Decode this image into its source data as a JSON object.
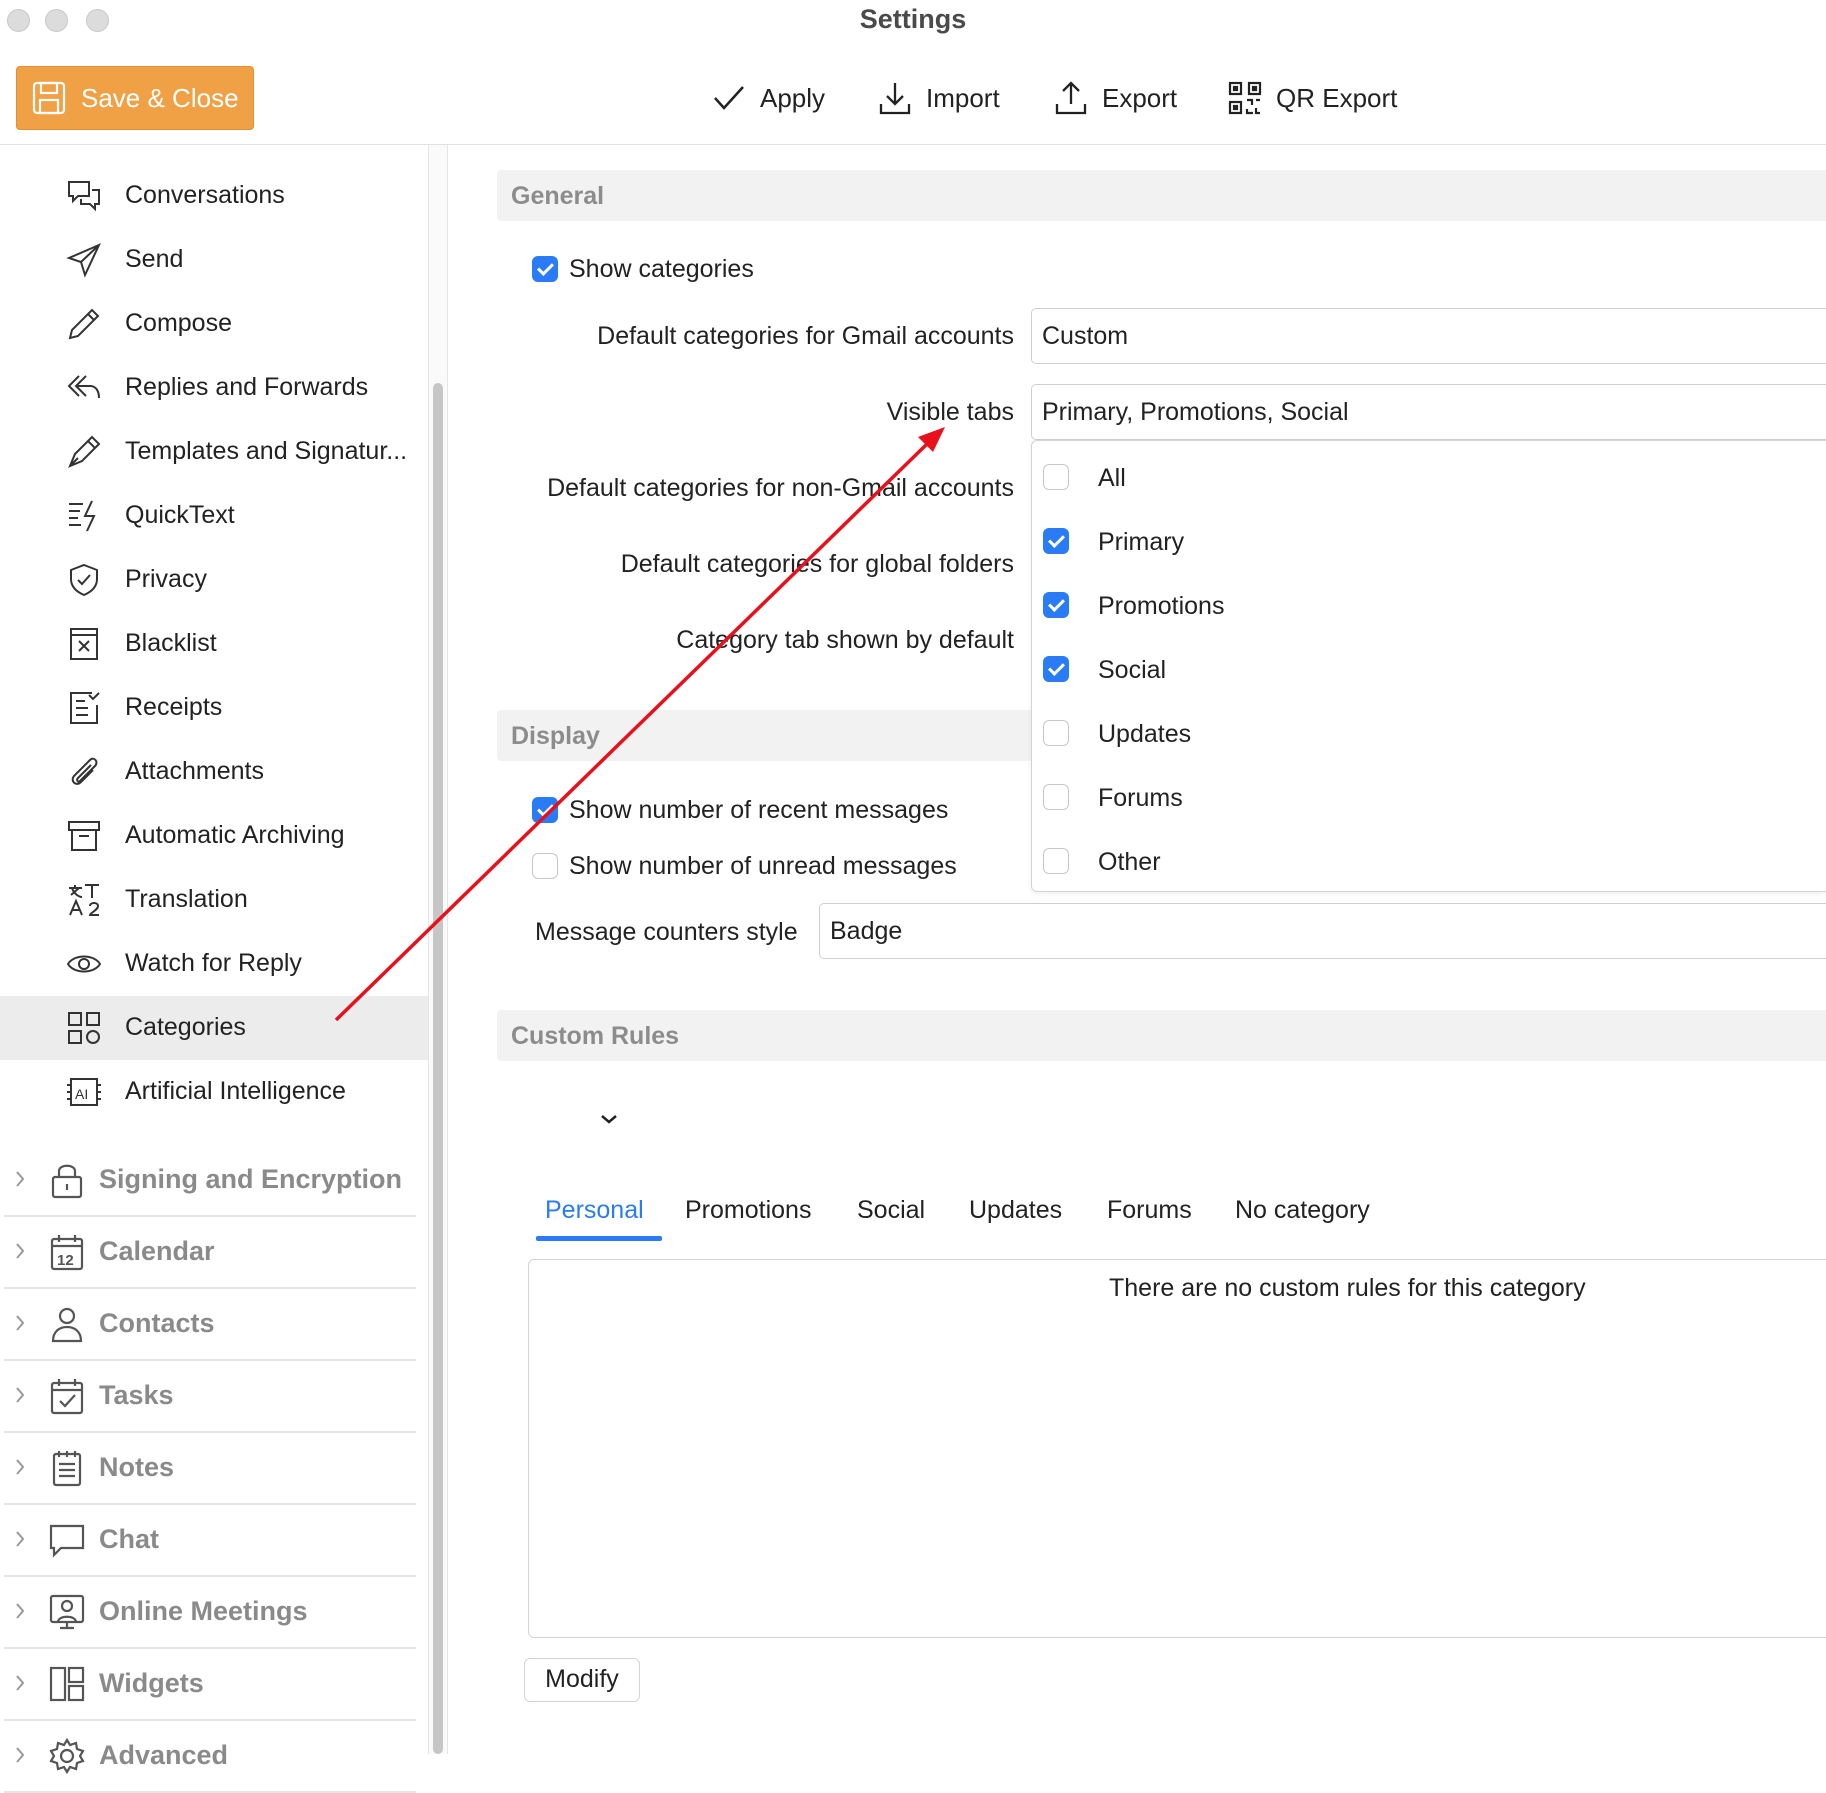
{
  "window": {
    "title": "Settings"
  },
  "toolbar": {
    "save_close": "Save & Close",
    "apply": "Apply",
    "import": "Import",
    "export": "Export",
    "qr_export": "QR Export"
  },
  "sidebar": {
    "items": [
      {
        "label": "Conversations",
        "icon": "conversations-icon"
      },
      {
        "label": "Send",
        "icon": "send-icon"
      },
      {
        "label": "Compose",
        "icon": "compose-icon"
      },
      {
        "label": "Replies and Forwards",
        "icon": "reply-icon"
      },
      {
        "label": "Templates and Signatur...",
        "icon": "pen-icon"
      },
      {
        "label": "QuickText",
        "icon": "quicktext-icon"
      },
      {
        "label": "Privacy",
        "icon": "shield-icon"
      },
      {
        "label": "Blacklist",
        "icon": "blacklist-icon"
      },
      {
        "label": "Receipts",
        "icon": "receipts-icon"
      },
      {
        "label": "Attachments",
        "icon": "paperclip-icon"
      },
      {
        "label": "Automatic Archiving",
        "icon": "archive-icon"
      },
      {
        "label": "Translation",
        "icon": "translation-icon"
      },
      {
        "label": "Watch for Reply",
        "icon": "eye-icon"
      },
      {
        "label": "Categories",
        "icon": "categories-icon",
        "selected": true
      },
      {
        "label": "Artificial Intelligence",
        "icon": "ai-icon"
      }
    ],
    "groups": [
      {
        "label": "Signing and Encryption",
        "icon": "lock-icon"
      },
      {
        "label": "Calendar",
        "icon": "calendar-icon",
        "icon_text": "12"
      },
      {
        "label": "Contacts",
        "icon": "person-icon"
      },
      {
        "label": "Tasks",
        "icon": "tasks-icon"
      },
      {
        "label": "Notes",
        "icon": "notes-icon"
      },
      {
        "label": "Chat",
        "icon": "chat-icon"
      },
      {
        "label": "Online Meetings",
        "icon": "meetings-icon"
      },
      {
        "label": "Widgets",
        "icon": "widgets-icon"
      },
      {
        "label": "Advanced",
        "icon": "gear-icon"
      }
    ]
  },
  "general": {
    "header": "General",
    "show_categories": "Show categories",
    "gmail_label": "Default categories for Gmail accounts",
    "gmail_value": "Custom",
    "visible_tabs_label": "Visible tabs",
    "visible_tabs_value": "Primary, Promotions, Social",
    "non_gmail_label": "Default categories for non-Gmail accounts",
    "global_label": "Default categories for global folders",
    "default_tab_label": "Category tab shown by default"
  },
  "visible_tabs_dropdown": [
    {
      "label": "All",
      "checked": false
    },
    {
      "label": "Primary",
      "checked": true
    },
    {
      "label": "Promotions",
      "checked": true
    },
    {
      "label": "Social",
      "checked": true
    },
    {
      "label": "Updates",
      "checked": false
    },
    {
      "label": "Forums",
      "checked": false
    },
    {
      "label": "Other",
      "checked": false
    }
  ],
  "display": {
    "header": "Display",
    "recent": "Show number of recent messages",
    "unread": "Show number of unread messages",
    "counter_label": "Message counters style",
    "counter_value": "Badge"
  },
  "custom_rules": {
    "header": "Custom Rules",
    "tabs": [
      "Personal",
      "Promotions",
      "Social",
      "Updates",
      "Forums",
      "No category"
    ],
    "empty_text": "There are no custom rules for this category",
    "modify": "Modify"
  },
  "colors": {
    "accent": "#2a7bf6",
    "save_button": "#f0a146",
    "annotation_arrow": "#e8101a"
  }
}
